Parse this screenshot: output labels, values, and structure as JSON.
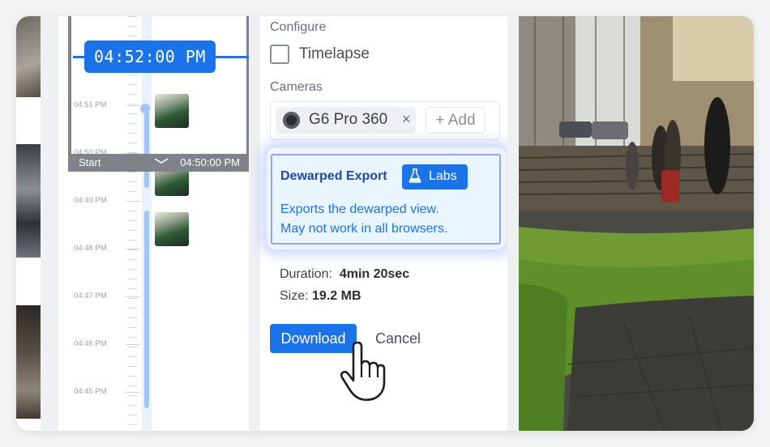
{
  "timeline": {
    "current_time": "04:52:00 PM",
    "selection": {
      "start_label": "Start",
      "end_time": "04:50:00 PM"
    },
    "labels": [
      {
        "text": "04:51 PM"
      },
      {
        "text": "04:50 PM"
      },
      {
        "text": "04:49 PM"
      },
      {
        "text": "04:48 PM"
      },
      {
        "text": "04:47 PM"
      },
      {
        "text": "04:46 PM"
      },
      {
        "text": "04:45 PM"
      }
    ]
  },
  "export_panel": {
    "configure_label": "Configure",
    "timelapse_label": "Timelapse",
    "timelapse_checked": false,
    "cameras_label": "Cameras",
    "camera_chip": "G6 Pro 360",
    "remove_glyph": "×",
    "add_button": "+ Add",
    "dewarped": {
      "title": "Dewarped Export",
      "badge": "Labs",
      "description_line1": "Exports the dewarped view.",
      "description_line2": "May not work in all browsers."
    },
    "duration_label": "Duration:",
    "duration_value": "4min 20sec",
    "size_label": "Size:",
    "size_value": "19.2 MB",
    "download_button": "Download",
    "cancel_button": "Cancel"
  },
  "colors": {
    "accent": "#1a73e8",
    "labs_glow": "#8fa2ff",
    "sofa_green": "#5e8f2a"
  },
  "icons": [
    "flask-icon",
    "camera-icon",
    "close-icon",
    "chevron-down-icon",
    "hand-pointer-icon",
    "checkbox-icon"
  ]
}
